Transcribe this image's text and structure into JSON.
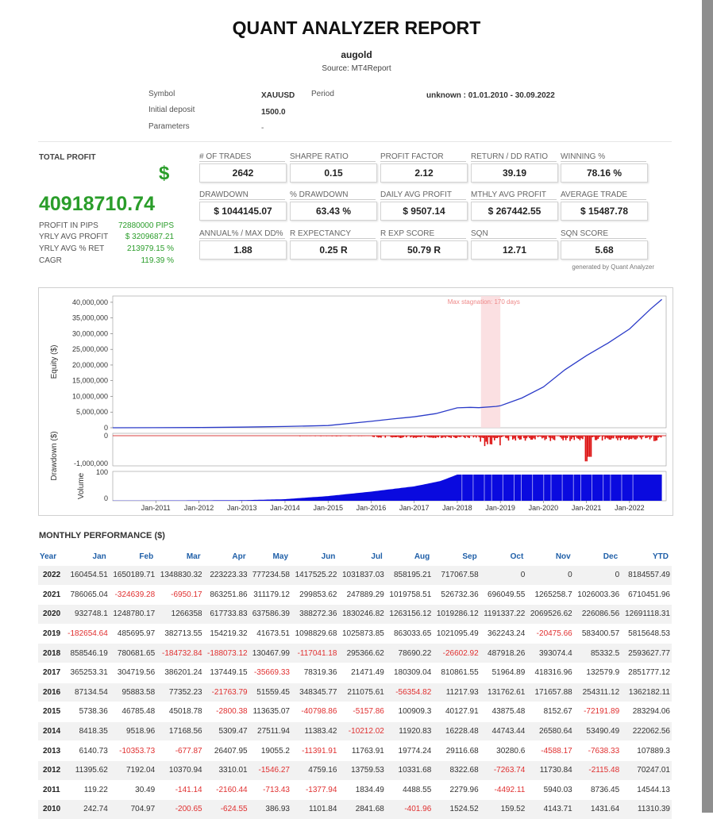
{
  "report": {
    "title": "QUANT ANALYZER REPORT",
    "strategy": "augold",
    "source": "Source: MT4Report"
  },
  "meta": {
    "symbol_label": "Symbol",
    "symbol_value": "XAUUSD",
    "period_label": "Period",
    "period_value": "unknown : 01.01.2010 - 30.09.2022",
    "deposit_label": "Initial deposit",
    "deposit_value": "1500.0",
    "params_label": "Parameters",
    "params_value": "-"
  },
  "total_profit": {
    "label": "TOTAL PROFIT",
    "currency": "$",
    "value": "40918710.74",
    "stats": [
      {
        "label": "PROFIT IN PIPS",
        "value": "72880000 PIPS"
      },
      {
        "label": "YRLY AVG PROFIT",
        "value": "$ 3209687.21"
      },
      {
        "label": "YRLY AVG % RET",
        "value": "213979.15 %"
      },
      {
        "label": "CAGR",
        "value": "119.39 %"
      }
    ]
  },
  "metrics": [
    {
      "label": "# OF TRADES",
      "value": "2642"
    },
    {
      "label": "SHARPE RATIO",
      "value": "0.15"
    },
    {
      "label": "PROFIT FACTOR",
      "value": "2.12"
    },
    {
      "label": "RETURN / DD RATIO",
      "value": "39.19"
    },
    {
      "label": "WINNING %",
      "value": "78.16 %"
    },
    {
      "label": "DRAWDOWN",
      "value": "$ 1044145.07"
    },
    {
      "label": "% DRAWDOWN",
      "value": "63.43 %"
    },
    {
      "label": "DAILY AVG PROFIT",
      "value": "$ 9507.14"
    },
    {
      "label": "MTHLY AVG PROFIT",
      "value": "$ 267442.55"
    },
    {
      "label": "AVERAGE TRADE",
      "value": "$ 15487.78"
    },
    {
      "label": "ANNUAL% / MAX DD%",
      "value": "1.88"
    },
    {
      "label": "R EXPECTANCY",
      "value": "0.25 R"
    },
    {
      "label": "R EXP SCORE",
      "value": "50.79 R"
    },
    {
      "label": "SQN",
      "value": "12.71"
    },
    {
      "label": "SQN SCORE",
      "value": "5.68"
    }
  ],
  "generated_by": "generated by Quant Analyzer",
  "chart_data": {
    "type": "line",
    "annotation": "Max stagnation: 170 days",
    "x_ticks": [
      "Jan-2011",
      "Jan-2012",
      "Jan-2013",
      "Jan-2014",
      "Jan-2015",
      "Jan-2016",
      "Jan-2017",
      "Jan-2018",
      "Jan-2019",
      "Jan-2020",
      "Jan-2021",
      "Jan-2022"
    ],
    "equity": {
      "ylabel": "Equity ($)",
      "ylim": [
        0,
        42000000
      ],
      "y_ticks": [
        "40,000,000",
        "35,000,000",
        "30,000,000",
        "25,000,000",
        "20,000,000",
        "15,000,000",
        "10,000,000",
        "5,000,000",
        "0"
      ],
      "y_tick_values": [
        40000000,
        35000000,
        30000000,
        25000000,
        20000000,
        15000000,
        10000000,
        5000000,
        0
      ],
      "x": [
        2010.0,
        2011.0,
        2012.0,
        2013.0,
        2014.0,
        2015.0,
        2016.0,
        2016.5,
        2017.0,
        2017.5,
        2018.0,
        2018.3,
        2018.5,
        2018.9,
        2019.0,
        2019.5,
        2020.0,
        2020.5,
        2021.0,
        2021.5,
        2022.0,
        2022.5,
        2022.75
      ],
      "values": [
        1500,
        15000,
        85000,
        195000,
        415000,
        700000,
        2060000,
        2800000,
        3500000,
        4500000,
        6350000,
        6500000,
        6400000,
        6800000,
        7000000,
        9500000,
        13000000,
        18500000,
        23000000,
        27000000,
        31500000,
        38000000,
        40900000
      ]
    },
    "drawdown": {
      "ylabel": "Drawdown ($)",
      "y_ticks": [
        "0",
        "-1,000,000"
      ],
      "ylim": [
        -1100000,
        0
      ]
    },
    "volume": {
      "ylabel": "Volume",
      "y_ticks": [
        "100",
        "0"
      ],
      "ylim": [
        0,
        100
      ]
    },
    "stagnation_range": [
      2018.55,
      2019.0
    ]
  },
  "monthly": {
    "title": "MONTHLY PERFORMANCE ($)",
    "headers": [
      "Year",
      "Jan",
      "Feb",
      "Mar",
      "Apr",
      "May",
      "Jun",
      "Jul",
      "Aug",
      "Sep",
      "Oct",
      "Nov",
      "Dec",
      "YTD"
    ],
    "rows": [
      [
        "2022",
        "160454.51",
        "1650189.71",
        "1348830.32",
        "223223.33",
        "777234.58",
        "1417525.22",
        "1031837.03",
        "858195.21",
        "717067.58",
        "0",
        "0",
        "0",
        "8184557.49"
      ],
      [
        "2021",
        "786065.04",
        "-324639.28",
        "-6950.17",
        "863251.86",
        "311179.12",
        "299853.62",
        "247889.29",
        "1019758.51",
        "526732.36",
        "696049.55",
        "1265258.7",
        "1026003.36",
        "6710451.96"
      ],
      [
        "2020",
        "932748.1",
        "1248780.17",
        "1266358",
        "617733.83",
        "637586.39",
        "388272.36",
        "1830246.82",
        "1263156.12",
        "1019286.12",
        "1191337.22",
        "2069526.62",
        "226086.56",
        "12691118.31"
      ],
      [
        "2019",
        "-182654.64",
        "485695.97",
        "382713.55",
        "154219.32",
        "41673.51",
        "1098829.68",
        "1025873.85",
        "863033.65",
        "1021095.49",
        "362243.24",
        "-20475.66",
        "583400.57",
        "5815648.53"
      ],
      [
        "2018",
        "858546.19",
        "780681.65",
        "-184732.84",
        "-188073.12",
        "130467.99",
        "-117041.18",
        "295366.62",
        "78690.22",
        "-26602.92",
        "487918.26",
        "393074.4",
        "85332.5",
        "2593627.77"
      ],
      [
        "2017",
        "365253.31",
        "304719.56",
        "386201.24",
        "137449.15",
        "-35669.33",
        "78319.36",
        "21471.49",
        "180309.04",
        "810861.55",
        "51964.89",
        "418316.96",
        "132579.9",
        "2851777.12"
      ],
      [
        "2016",
        "87134.54",
        "95883.58",
        "77352.23",
        "-21763.79",
        "51559.45",
        "348345.77",
        "211075.61",
        "-56354.82",
        "11217.93",
        "131762.61",
        "171657.88",
        "254311.12",
        "1362182.11"
      ],
      [
        "2015",
        "5738.36",
        "46785.48",
        "45018.78",
        "-2800.38",
        "113635.07",
        "-40798.86",
        "-5157.86",
        "100909.3",
        "40127.91",
        "43875.48",
        "8152.67",
        "-72191.89",
        "283294.06"
      ],
      [
        "2014",
        "8418.35",
        "9518.96",
        "17168.56",
        "5309.47",
        "27511.94",
        "11383.42",
        "-10212.02",
        "11920.83",
        "16228.48",
        "44743.44",
        "26580.64",
        "53490.49",
        "222062.56"
      ],
      [
        "2013",
        "6140.73",
        "-10353.73",
        "-677.87",
        "26407.95",
        "19055.2",
        "-11391.91",
        "11763.91",
        "19774.24",
        "29116.68",
        "30280.6",
        "-4588.17",
        "-7638.33",
        "107889.3"
      ],
      [
        "2012",
        "11395.62",
        "7192.04",
        "10370.94",
        "3310.01",
        "-1546.27",
        "4759.16",
        "13759.53",
        "10331.68",
        "8322.68",
        "-7263.74",
        "11730.84",
        "-2115.48",
        "70247.01"
      ],
      [
        "2011",
        "119.22",
        "30.49",
        "-141.14",
        "-2160.44",
        "-713.43",
        "-1377.94",
        "1834.49",
        "4488.55",
        "2279.96",
        "-4492.11",
        "5940.03",
        "8736.45",
        "14544.13"
      ],
      [
        "2010",
        "242.74",
        "704.97",
        "-200.65",
        "-624.55",
        "386.93",
        "1101.84",
        "2841.68",
        "-401.96",
        "1524.52",
        "159.52",
        "4143.71",
        "1431.64",
        "11310.39"
      ]
    ]
  }
}
